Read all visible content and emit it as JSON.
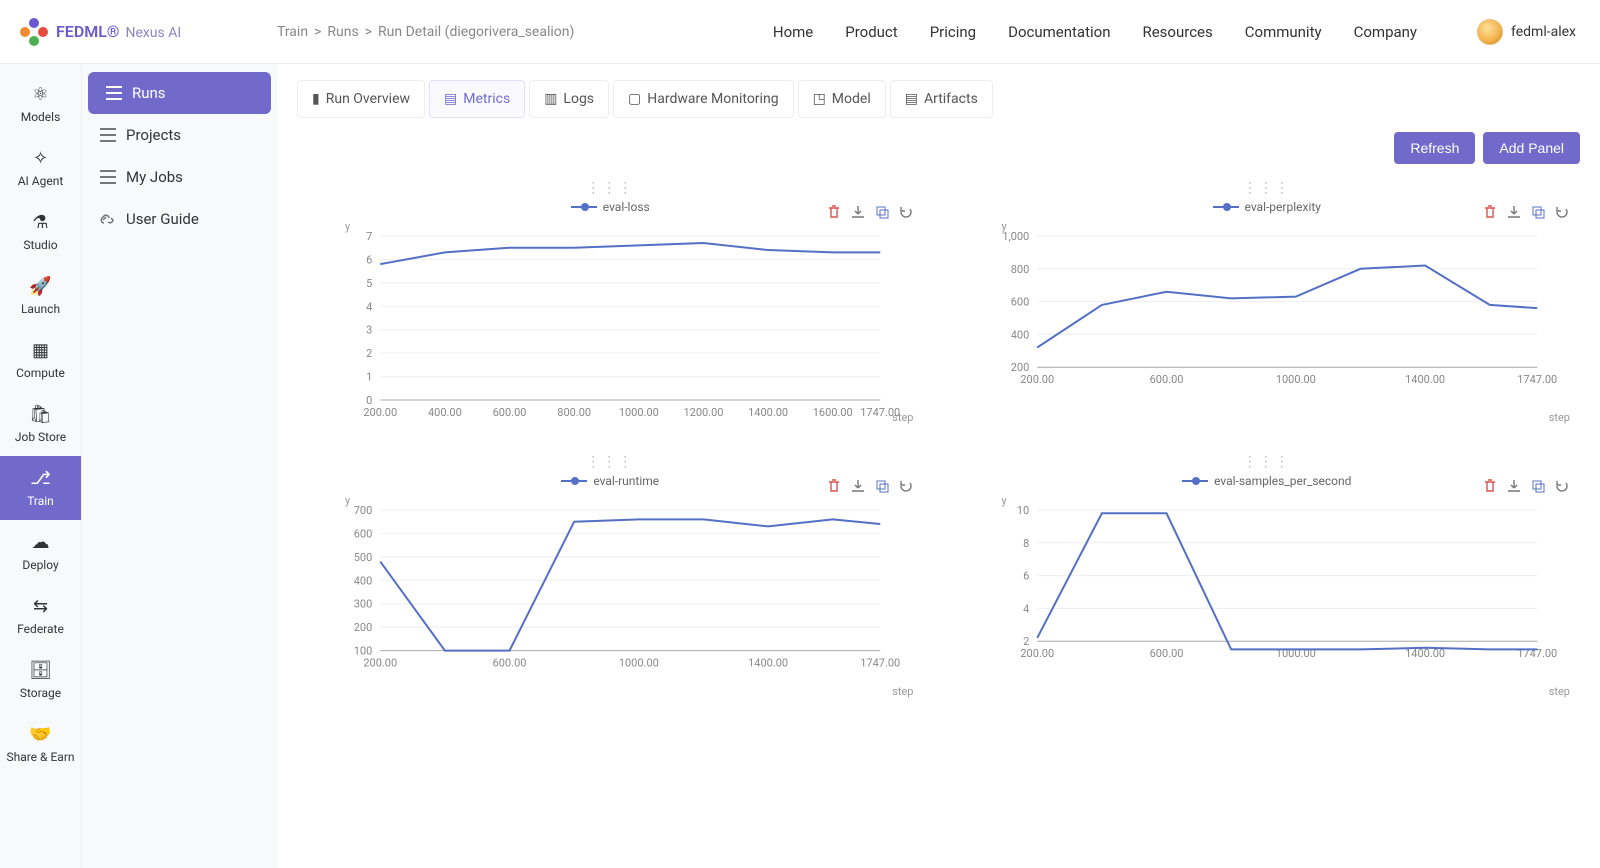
{
  "brand": {
    "name": "FEDML®",
    "sub": "Nexus AI"
  },
  "breadcrumbs": {
    "a": "Train",
    "b": "Runs",
    "c": "Run Detail (diegorivera_sealion)"
  },
  "topnav": [
    "Home",
    "Product",
    "Pricing",
    "Documentation",
    "Resources",
    "Community",
    "Company"
  ],
  "user": {
    "name": "fedml-alex"
  },
  "iconbar": [
    {
      "id": "models",
      "label": "Models"
    },
    {
      "id": "ai-agent",
      "label": "AI Agent"
    },
    {
      "id": "studio",
      "label": "Studio"
    },
    {
      "id": "launch",
      "label": "Launch"
    },
    {
      "id": "compute",
      "label": "Compute"
    },
    {
      "id": "job-store",
      "label": "Job Store"
    },
    {
      "id": "train",
      "label": "Train"
    },
    {
      "id": "deploy",
      "label": "Deploy"
    },
    {
      "id": "federate",
      "label": "Federate"
    },
    {
      "id": "storage",
      "label": "Storage"
    },
    {
      "id": "share-earn",
      "label": "Share & Earn"
    }
  ],
  "secnav": [
    {
      "id": "runs",
      "label": "Runs"
    },
    {
      "id": "projects",
      "label": "Projects"
    },
    {
      "id": "my-jobs",
      "label": "My Jobs"
    },
    {
      "id": "user-guide",
      "label": "User Guide"
    }
  ],
  "tabs": [
    {
      "id": "overview",
      "label": "Run Overview"
    },
    {
      "id": "metrics",
      "label": "Metrics"
    },
    {
      "id": "logs",
      "label": "Logs"
    },
    {
      "id": "hw",
      "label": "Hardware Monitoring"
    },
    {
      "id": "model",
      "label": "Model"
    },
    {
      "id": "artifacts",
      "label": "Artifacts"
    }
  ],
  "actions": {
    "refresh": "Refresh",
    "add_panel": "Add Panel"
  },
  "chart_data": [
    {
      "id": "eval-loss",
      "type": "line",
      "title": "eval-loss",
      "xlabel": "step",
      "ylabel": "y",
      "ylim": [
        0,
        7
      ],
      "yticks": [
        0,
        1,
        2,
        3,
        4,
        5,
        6,
        7
      ],
      "xticks": [
        200,
        400,
        600,
        800,
        1000,
        1200,
        1400,
        1600,
        1747
      ],
      "xtick_labels": [
        "200.00",
        "400.00",
        "600.00",
        "800.00",
        "1000.00",
        "1200.00",
        "1400.00",
        "1600.00",
        "1747.00"
      ],
      "x": [
        200,
        400,
        600,
        800,
        1000,
        1200,
        1400,
        1600,
        1747
      ],
      "values": [
        5.8,
        6.3,
        6.5,
        6.5,
        6.6,
        6.7,
        6.4,
        6.3,
        6.3
      ]
    },
    {
      "id": "eval-perplexity",
      "type": "line",
      "title": "eval-perplexity",
      "xlabel": "step",
      "ylabel": "y",
      "ylim": [
        0,
        1000
      ],
      "yticks": [
        200,
        400,
        600,
        800,
        1000
      ],
      "xticks": [
        200,
        600,
        1000,
        1400,
        1747
      ],
      "xtick_labels": [
        "200.00",
        "600.00",
        "1000.00",
        "1400.00",
        "1747.00"
      ],
      "x": [
        200,
        400,
        600,
        800,
        1000,
        1200,
        1400,
        1600,
        1747
      ],
      "values": [
        320,
        580,
        660,
        620,
        630,
        800,
        820,
        580,
        560
      ]
    },
    {
      "id": "eval-runtime",
      "type": "line",
      "title": "eval-runtime",
      "xlabel": "step",
      "ylabel": "y",
      "ylim": [
        0,
        700
      ],
      "yticks": [
        100,
        200,
        300,
        400,
        500,
        600,
        700
      ],
      "xticks": [
        200,
        600,
        1000,
        1400,
        1747
      ],
      "xtick_labels": [
        "200.00",
        "600.00",
        "1000.00",
        "1400.00",
        "1747.00"
      ],
      "x": [
        200,
        400,
        600,
        800,
        1000,
        1200,
        1400,
        1600,
        1747
      ],
      "values": [
        480,
        100,
        100,
        650,
        660,
        660,
        630,
        660,
        640
      ]
    },
    {
      "id": "eval-samples-per-second",
      "type": "line",
      "title": "eval-samples_per_second",
      "xlabel": "step",
      "ylabel": "y",
      "ylim": [
        0,
        10
      ],
      "yticks": [
        2,
        4,
        6,
        8,
        10
      ],
      "xticks": [
        200,
        600,
        1000,
        1400,
        1747
      ],
      "xtick_labels": [
        "200.00",
        "600.00",
        "1000.00",
        "1400.00",
        "1747.00"
      ],
      "x": [
        200,
        400,
        600,
        800,
        1000,
        1200,
        1400,
        1600,
        1747
      ],
      "values": [
        2.2,
        9.8,
        9.8,
        1.5,
        1.5,
        1.5,
        1.6,
        1.5,
        1.5
      ]
    }
  ]
}
